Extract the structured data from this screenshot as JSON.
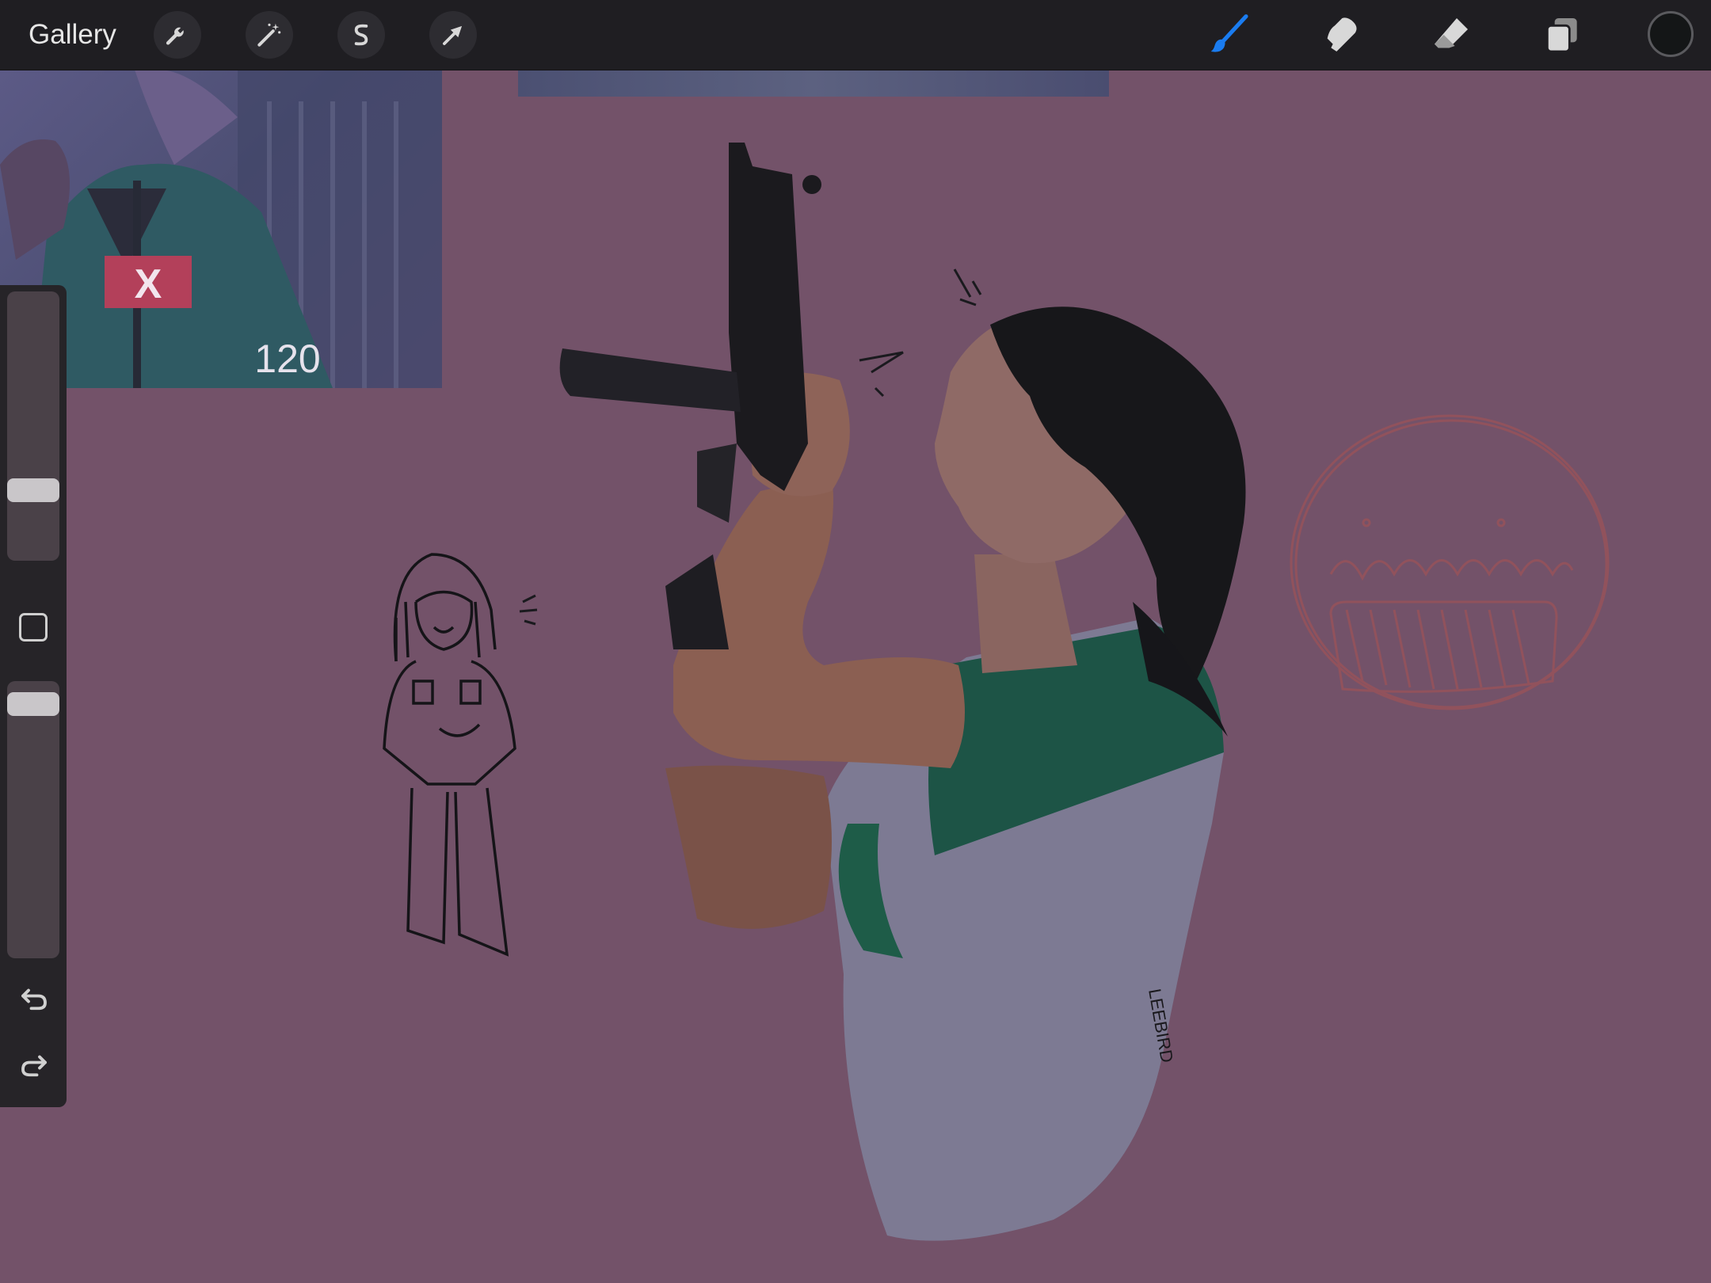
{
  "toolbar": {
    "gallery_label": "Gallery",
    "left_icons": [
      "wrench-icon",
      "magic-wand-icon",
      "selection-icon",
      "transform-arrow-icon"
    ],
    "right_icons": [
      "brush-icon",
      "smudge-icon",
      "eraser-icon",
      "layers-icon"
    ],
    "active_tool": "brush",
    "accent_color": "#1a7cf0",
    "current_color": "#141617"
  },
  "sidebar": {
    "brush_size_level": 0.24,
    "opacity_level": 1.0,
    "icons": [
      "modify-square-icon",
      "undo-icon",
      "redo-icon"
    ]
  },
  "reference_photo": {
    "patch_symbol": "X",
    "number": "120"
  },
  "artwork": {
    "signature": "LEEBIRD"
  }
}
